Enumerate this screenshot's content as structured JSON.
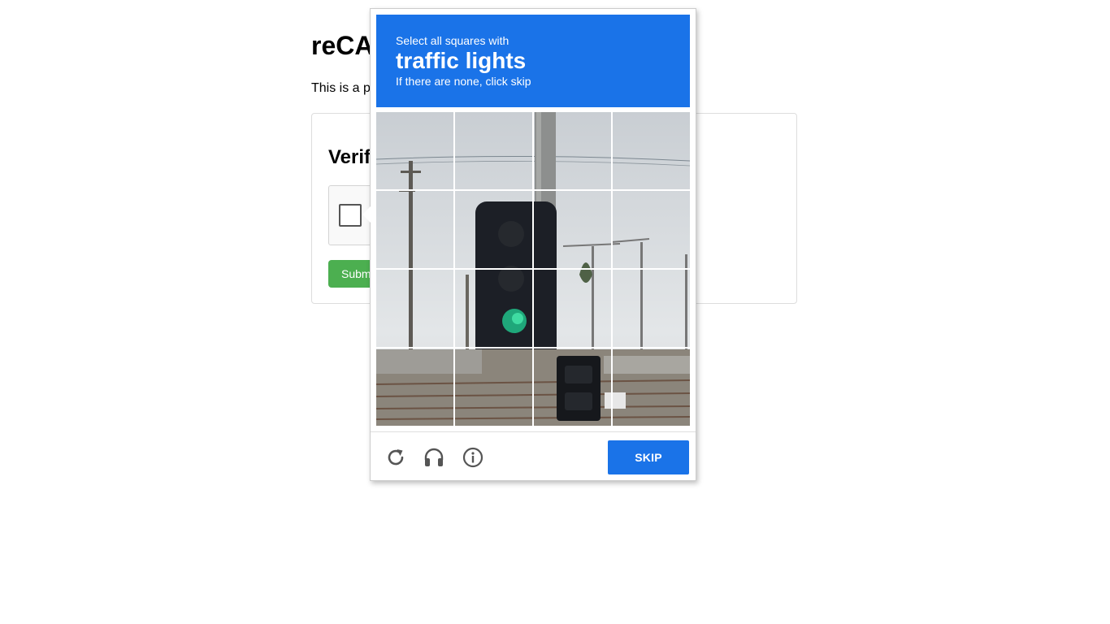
{
  "page": {
    "title": "reCAPTCHA demo",
    "description": "This is a page with a reCAPTCHA challenge.",
    "card_title": "Verify you are human",
    "submit_label": "Submit"
  },
  "challenge": {
    "line1": "Select all squares with",
    "line2": "traffic lights",
    "line3": "If there are none, click skip",
    "grid_rows": 4,
    "grid_cols": 4,
    "tiles_selected": [],
    "footer_icons": [
      "reload-icon",
      "headphones-icon",
      "info-icon"
    ],
    "skip_label": "SKIP",
    "accent_color": "#1a73e8"
  },
  "colors": {
    "submit_button": "#4caf50",
    "header_background": "#1a73e8"
  }
}
